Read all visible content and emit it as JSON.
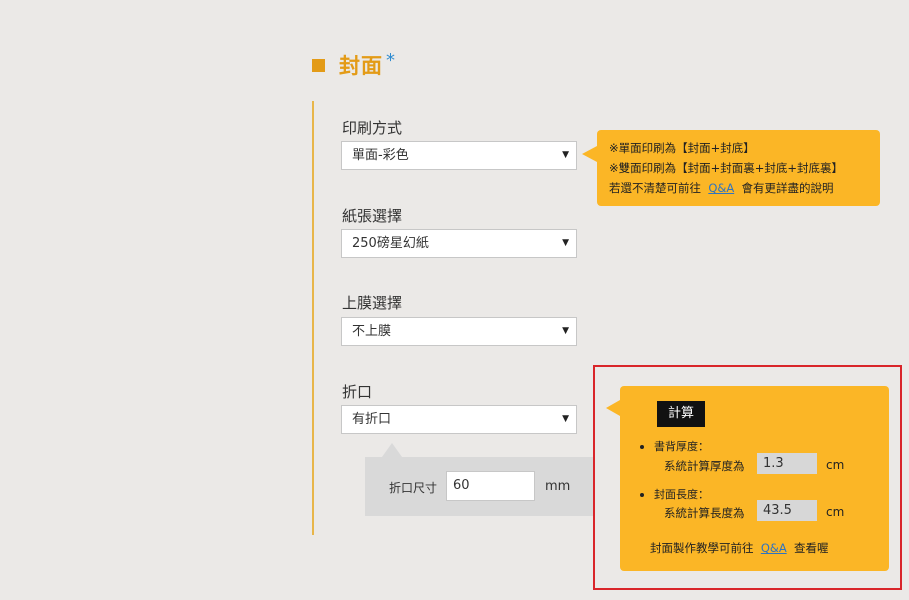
{
  "section": {
    "title": "封面",
    "required_mark": "*"
  },
  "fields": [
    {
      "label": "印刷方式",
      "value": "單面-彩色"
    },
    {
      "label": "紙張選擇",
      "value": "250磅星幻紙"
    },
    {
      "label": "上膜選擇",
      "value": "不上膜"
    },
    {
      "label": "折口",
      "value": "有折口"
    }
  ],
  "print_tip": {
    "line1": "※單面印刷為【封面+封底】",
    "line2": "※雙面印刷為【封面+封面裏+封底+封底裏】",
    "line3_prefix": "若還不清楚可前往",
    "line3_link": "Q&A",
    "line3_suffix": "會有更詳盡的說明"
  },
  "fold": {
    "label": "折口尺寸",
    "value": "60",
    "unit": "mm"
  },
  "calculator": {
    "button_label": "計算",
    "spine": {
      "title": "書背厚度：",
      "label": "系統計算厚度為",
      "value": "1.3",
      "unit": "cm"
    },
    "cover": {
      "title": "封面長度：",
      "label": "系統計算長度為",
      "value": "43.5",
      "unit": "cm"
    },
    "footer_prefix": "封面製作教學可前往",
    "footer_link": "Q&A",
    "footer_suffix": "查看喔"
  },
  "icons": {
    "select_caret": "▼"
  },
  "colors": {
    "accent": "#e39b17",
    "tip_bg": "#fbb626",
    "highlight_border": "#d9252a",
    "link": "#2f74c0"
  }
}
